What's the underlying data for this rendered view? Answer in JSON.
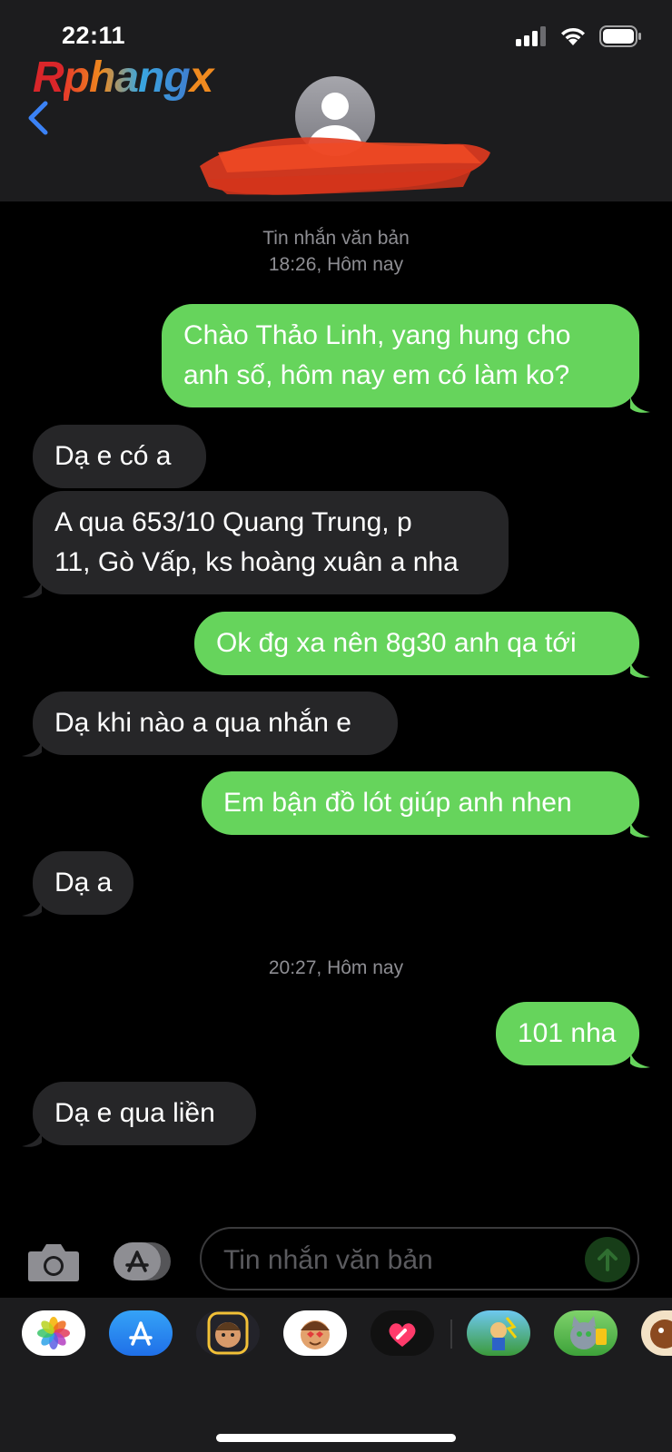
{
  "status_bar": {
    "time": "22:11"
  },
  "watermark": {
    "part1": "R",
    "part2": "phang",
    "part3": "x"
  },
  "conversation": [
    {
      "type": "meta",
      "lines": [
        "Tin nhắn văn bản",
        "18:26, Hôm nay"
      ]
    },
    {
      "type": "sent",
      "lines": [
        "Chào Thảo Linh, yang hung cho",
        "anh số, hôm nay em có làm ko?"
      ]
    },
    {
      "type": "received",
      "lines": [
        "Dạ e có a"
      ]
    },
    {
      "type": "received",
      "lines": [
        "A qua 653/10 Quang Trung, p",
        "11, Gò Vấp, ks hoàng xuân a nha"
      ]
    },
    {
      "type": "sent",
      "lines": [
        "Ok đg xa nên 8g30 anh qa tới"
      ]
    },
    {
      "type": "received",
      "lines": [
        "Dạ khi nào a qua nhắn e"
      ]
    },
    {
      "type": "sent",
      "lines": [
        "Em bận đồ lót giúp anh nhen"
      ]
    },
    {
      "type": "received",
      "lines": [
        "Dạ a"
      ]
    },
    {
      "type": "meta",
      "lines": [
        "20:27, Hôm nay"
      ]
    },
    {
      "type": "sent",
      "lines": [
        "101 nha"
      ]
    },
    {
      "type": "received",
      "lines": [
        "Dạ e qua liền"
      ]
    }
  ],
  "composer": {
    "placeholder": "Tin nhắn văn bản"
  },
  "app_tray": [
    "photos-icon",
    "app-store-icon",
    "memoji-icon",
    "animoji-icon",
    "digital-touch-icon",
    "game-app-icon",
    "talking-tom-icon",
    "game-app-icon-2"
  ],
  "colors": {
    "sent_bubble": "#66d45c",
    "received_bubble": "#262628",
    "accent": "#3b82f6"
  }
}
